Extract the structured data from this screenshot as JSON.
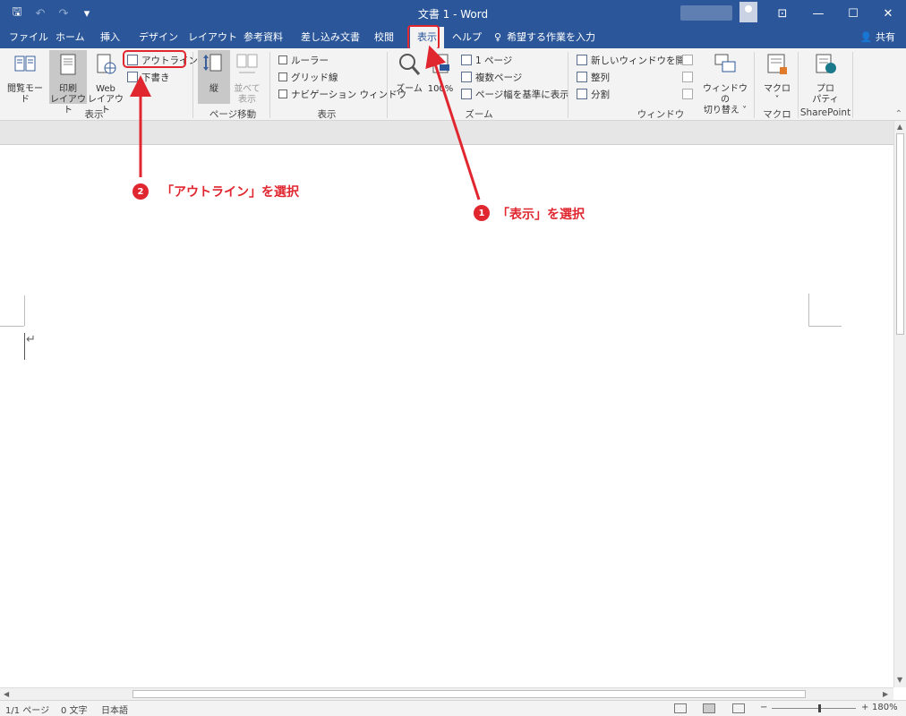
{
  "app": {
    "title": "文書 1  -  Word",
    "window_controls": {
      "ribbon_display": "⊡",
      "minimize": "—",
      "maximize": "☐",
      "close": "✕"
    }
  },
  "qat": {
    "save": "🖫",
    "undo": "↶",
    "redo": "↷",
    "customize": "▾"
  },
  "tabs": [
    {
      "label": "ファイル"
    },
    {
      "label": "ホーム"
    },
    {
      "label": "挿入"
    },
    {
      "label": "デザイン"
    },
    {
      "label": "レイアウト"
    },
    {
      "label": "参考資料"
    },
    {
      "label": "差し込み文書"
    },
    {
      "label": "校閲"
    },
    {
      "label": "表示",
      "active": true
    },
    {
      "label": "ヘルプ"
    },
    {
      "label": "希望する作業を入力",
      "icon": "lightbulb-icon"
    }
  ],
  "share_label": "共有",
  "ribbon": {
    "views": {
      "group_label": "表示",
      "read_mode": "閲覧モード",
      "print_layout_1": "印刷",
      "print_layout_2": "レイアウト",
      "web_layout_1": "Web",
      "web_layout_2": "レイアウト",
      "outline": "アウトライン",
      "draft": "下書き"
    },
    "page_movement": {
      "group_label": "ページ移動",
      "vertical": "縦",
      "side_by_side_1": "並べて",
      "side_by_side_2": "表示"
    },
    "show": {
      "group_label": "表示",
      "ruler": "ルーラー",
      "gridlines": "グリッド線",
      "nav_pane": "ナビゲーション ウィンドウ"
    },
    "zoom": {
      "group_label": "ズーム",
      "zoom": "ズーム",
      "hundred": "100%",
      "one_page": "1 ページ",
      "multiple_pages": "複数ページ",
      "page_width": "ページ幅を基準に表示"
    },
    "window": {
      "group_label": "ウィンドウ",
      "new_window": "新しいウィンドウを開く",
      "arrange_all": "整列",
      "split": "分割",
      "switch_1": "ウィンドウの",
      "switch_2": "切り替え ˅"
    },
    "macros": {
      "group_label": "マクロ",
      "macros": "マクロ",
      "caret": "˅"
    },
    "sharepoint": {
      "group_label": "SharePoint",
      "props_1": "プロ",
      "props_2": "パティ"
    }
  },
  "status": {
    "page": "1/1 ページ",
    "words": "0 文字",
    "language": "日本語",
    "zoom_minus": "−",
    "zoom_plus": "+",
    "zoom_level": "180%",
    "zoom_fraction": 0.56
  },
  "annotations": {
    "step1_number": "1",
    "step1_text": "「表示」を選択",
    "step2_number": "2",
    "step2_text": "「アウトライン」を選択"
  },
  "colors": {
    "accent": "#2b579a",
    "annotation": "#e0262f"
  }
}
